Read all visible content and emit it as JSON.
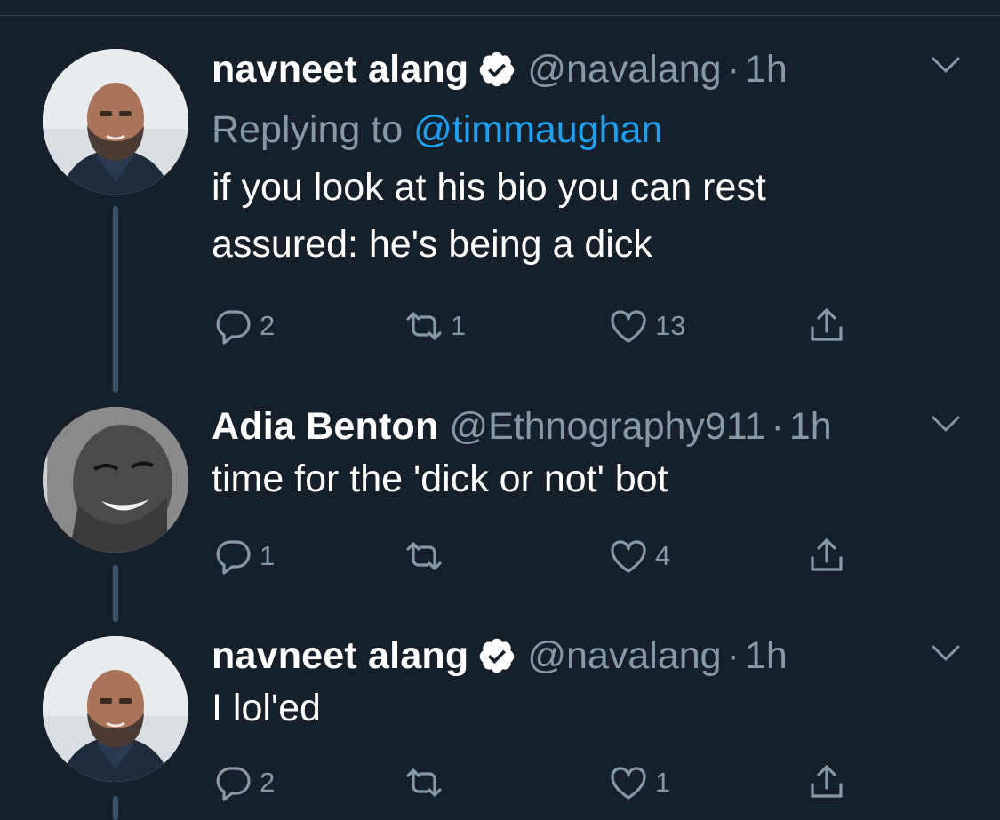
{
  "tweets": [
    {
      "display_name": "navneet alang",
      "verified": true,
      "handle": "@navalang",
      "dot": "·",
      "time": "1h",
      "reply_prefix": "Replying to",
      "reply_to": "@timmaughan",
      "text_lines": [
        "if you look at his bio you can rest",
        "assured: he's being a dick"
      ],
      "counts": {
        "reply": "2",
        "retweet": "1",
        "like": "13"
      }
    },
    {
      "display_name": "Adia Benton",
      "verified": false,
      "handle": "@Ethnography911",
      "dot": "·",
      "time": "1h",
      "text_lines": [
        "time for the 'dick or not' bot"
      ],
      "counts": {
        "reply": "1",
        "retweet": "",
        "like": "4"
      }
    },
    {
      "display_name": "navneet alang",
      "verified": true,
      "handle": "@navalang",
      "dot": "·",
      "time": "1h",
      "text_lines": [
        "I lol'ed"
      ],
      "counts": {
        "reply": "2",
        "retweet": "",
        "like": "1"
      }
    }
  ],
  "colors": {
    "background": "#15202b",
    "text_primary": "#ffffff",
    "text_secondary": "#8899a6",
    "link": "#1da1f2",
    "thread_line": "#3d5466"
  },
  "icons": [
    "verified-badge-icon",
    "chevron-down-icon",
    "reply-icon",
    "retweet-icon",
    "like-icon",
    "share-icon"
  ]
}
